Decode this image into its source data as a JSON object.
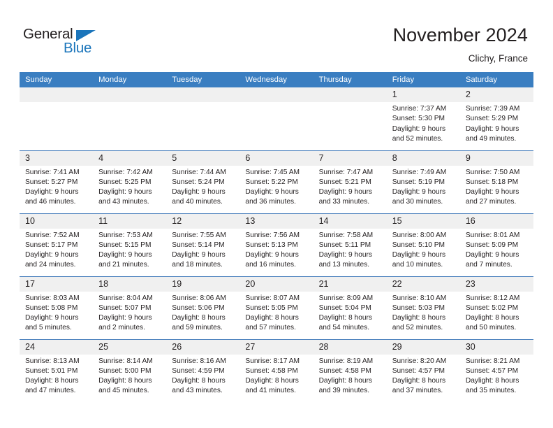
{
  "brand": {
    "name_part1": "General",
    "name_part2": "Blue",
    "triangle_color": "#1b75bb",
    "text_color": "#231f20"
  },
  "header": {
    "month_title": "November 2024",
    "location": "Clichy, France"
  },
  "theme": {
    "header_row_bg": "#3a7ec1",
    "header_row_text": "#ffffff",
    "daynum_bg": "#f0f0f0",
    "row_divider": "#4a80bd",
    "body_text": "#231f20"
  },
  "weekdays": [
    "Sunday",
    "Monday",
    "Tuesday",
    "Wednesday",
    "Thursday",
    "Friday",
    "Saturday"
  ],
  "weeks": [
    [
      {
        "day": "",
        "blank": true,
        "sunrise": "",
        "sunset": "",
        "daylight1": "",
        "daylight2": ""
      },
      {
        "day": "",
        "blank": true,
        "sunrise": "",
        "sunset": "",
        "daylight1": "",
        "daylight2": ""
      },
      {
        "day": "",
        "blank": true,
        "sunrise": "",
        "sunset": "",
        "daylight1": "",
        "daylight2": ""
      },
      {
        "day": "",
        "blank": true,
        "sunrise": "",
        "sunset": "",
        "daylight1": "",
        "daylight2": ""
      },
      {
        "day": "",
        "blank": true,
        "sunrise": "",
        "sunset": "",
        "daylight1": "",
        "daylight2": ""
      },
      {
        "day": "1",
        "sunrise": "Sunrise: 7:37 AM",
        "sunset": "Sunset: 5:30 PM",
        "daylight1": "Daylight: 9 hours",
        "daylight2": "and 52 minutes."
      },
      {
        "day": "2",
        "sunrise": "Sunrise: 7:39 AM",
        "sunset": "Sunset: 5:29 PM",
        "daylight1": "Daylight: 9 hours",
        "daylight2": "and 49 minutes."
      }
    ],
    [
      {
        "day": "3",
        "sunrise": "Sunrise: 7:41 AM",
        "sunset": "Sunset: 5:27 PM",
        "daylight1": "Daylight: 9 hours",
        "daylight2": "and 46 minutes."
      },
      {
        "day": "4",
        "sunrise": "Sunrise: 7:42 AM",
        "sunset": "Sunset: 5:25 PM",
        "daylight1": "Daylight: 9 hours",
        "daylight2": "and 43 minutes."
      },
      {
        "day": "5",
        "sunrise": "Sunrise: 7:44 AM",
        "sunset": "Sunset: 5:24 PM",
        "daylight1": "Daylight: 9 hours",
        "daylight2": "and 40 minutes."
      },
      {
        "day": "6",
        "sunrise": "Sunrise: 7:45 AM",
        "sunset": "Sunset: 5:22 PM",
        "daylight1": "Daylight: 9 hours",
        "daylight2": "and 36 minutes."
      },
      {
        "day": "7",
        "sunrise": "Sunrise: 7:47 AM",
        "sunset": "Sunset: 5:21 PM",
        "daylight1": "Daylight: 9 hours",
        "daylight2": "and 33 minutes."
      },
      {
        "day": "8",
        "sunrise": "Sunrise: 7:49 AM",
        "sunset": "Sunset: 5:19 PM",
        "daylight1": "Daylight: 9 hours",
        "daylight2": "and 30 minutes."
      },
      {
        "day": "9",
        "sunrise": "Sunrise: 7:50 AM",
        "sunset": "Sunset: 5:18 PM",
        "daylight1": "Daylight: 9 hours",
        "daylight2": "and 27 minutes."
      }
    ],
    [
      {
        "day": "10",
        "sunrise": "Sunrise: 7:52 AM",
        "sunset": "Sunset: 5:17 PM",
        "daylight1": "Daylight: 9 hours",
        "daylight2": "and 24 minutes."
      },
      {
        "day": "11",
        "sunrise": "Sunrise: 7:53 AM",
        "sunset": "Sunset: 5:15 PM",
        "daylight1": "Daylight: 9 hours",
        "daylight2": "and 21 minutes."
      },
      {
        "day": "12",
        "sunrise": "Sunrise: 7:55 AM",
        "sunset": "Sunset: 5:14 PM",
        "daylight1": "Daylight: 9 hours",
        "daylight2": "and 18 minutes."
      },
      {
        "day": "13",
        "sunrise": "Sunrise: 7:56 AM",
        "sunset": "Sunset: 5:13 PM",
        "daylight1": "Daylight: 9 hours",
        "daylight2": "and 16 minutes."
      },
      {
        "day": "14",
        "sunrise": "Sunrise: 7:58 AM",
        "sunset": "Sunset: 5:11 PM",
        "daylight1": "Daylight: 9 hours",
        "daylight2": "and 13 minutes."
      },
      {
        "day": "15",
        "sunrise": "Sunrise: 8:00 AM",
        "sunset": "Sunset: 5:10 PM",
        "daylight1": "Daylight: 9 hours",
        "daylight2": "and 10 minutes."
      },
      {
        "day": "16",
        "sunrise": "Sunrise: 8:01 AM",
        "sunset": "Sunset: 5:09 PM",
        "daylight1": "Daylight: 9 hours",
        "daylight2": "and 7 minutes."
      }
    ],
    [
      {
        "day": "17",
        "sunrise": "Sunrise: 8:03 AM",
        "sunset": "Sunset: 5:08 PM",
        "daylight1": "Daylight: 9 hours",
        "daylight2": "and 5 minutes."
      },
      {
        "day": "18",
        "sunrise": "Sunrise: 8:04 AM",
        "sunset": "Sunset: 5:07 PM",
        "daylight1": "Daylight: 9 hours",
        "daylight2": "and 2 minutes."
      },
      {
        "day": "19",
        "sunrise": "Sunrise: 8:06 AM",
        "sunset": "Sunset: 5:06 PM",
        "daylight1": "Daylight: 8 hours",
        "daylight2": "and 59 minutes."
      },
      {
        "day": "20",
        "sunrise": "Sunrise: 8:07 AM",
        "sunset": "Sunset: 5:05 PM",
        "daylight1": "Daylight: 8 hours",
        "daylight2": "and 57 minutes."
      },
      {
        "day": "21",
        "sunrise": "Sunrise: 8:09 AM",
        "sunset": "Sunset: 5:04 PM",
        "daylight1": "Daylight: 8 hours",
        "daylight2": "and 54 minutes."
      },
      {
        "day": "22",
        "sunrise": "Sunrise: 8:10 AM",
        "sunset": "Sunset: 5:03 PM",
        "daylight1": "Daylight: 8 hours",
        "daylight2": "and 52 minutes."
      },
      {
        "day": "23",
        "sunrise": "Sunrise: 8:12 AM",
        "sunset": "Sunset: 5:02 PM",
        "daylight1": "Daylight: 8 hours",
        "daylight2": "and 50 minutes."
      }
    ],
    [
      {
        "day": "24",
        "sunrise": "Sunrise: 8:13 AM",
        "sunset": "Sunset: 5:01 PM",
        "daylight1": "Daylight: 8 hours",
        "daylight2": "and 47 minutes."
      },
      {
        "day": "25",
        "sunrise": "Sunrise: 8:14 AM",
        "sunset": "Sunset: 5:00 PM",
        "daylight1": "Daylight: 8 hours",
        "daylight2": "and 45 minutes."
      },
      {
        "day": "26",
        "sunrise": "Sunrise: 8:16 AM",
        "sunset": "Sunset: 4:59 PM",
        "daylight1": "Daylight: 8 hours",
        "daylight2": "and 43 minutes."
      },
      {
        "day": "27",
        "sunrise": "Sunrise: 8:17 AM",
        "sunset": "Sunset: 4:58 PM",
        "daylight1": "Daylight: 8 hours",
        "daylight2": "and 41 minutes."
      },
      {
        "day": "28",
        "sunrise": "Sunrise: 8:19 AM",
        "sunset": "Sunset: 4:58 PM",
        "daylight1": "Daylight: 8 hours",
        "daylight2": "and 39 minutes."
      },
      {
        "day": "29",
        "sunrise": "Sunrise: 8:20 AM",
        "sunset": "Sunset: 4:57 PM",
        "daylight1": "Daylight: 8 hours",
        "daylight2": "and 37 minutes."
      },
      {
        "day": "30",
        "sunrise": "Sunrise: 8:21 AM",
        "sunset": "Sunset: 4:57 PM",
        "daylight1": "Daylight: 8 hours",
        "daylight2": "and 35 minutes."
      }
    ]
  ]
}
